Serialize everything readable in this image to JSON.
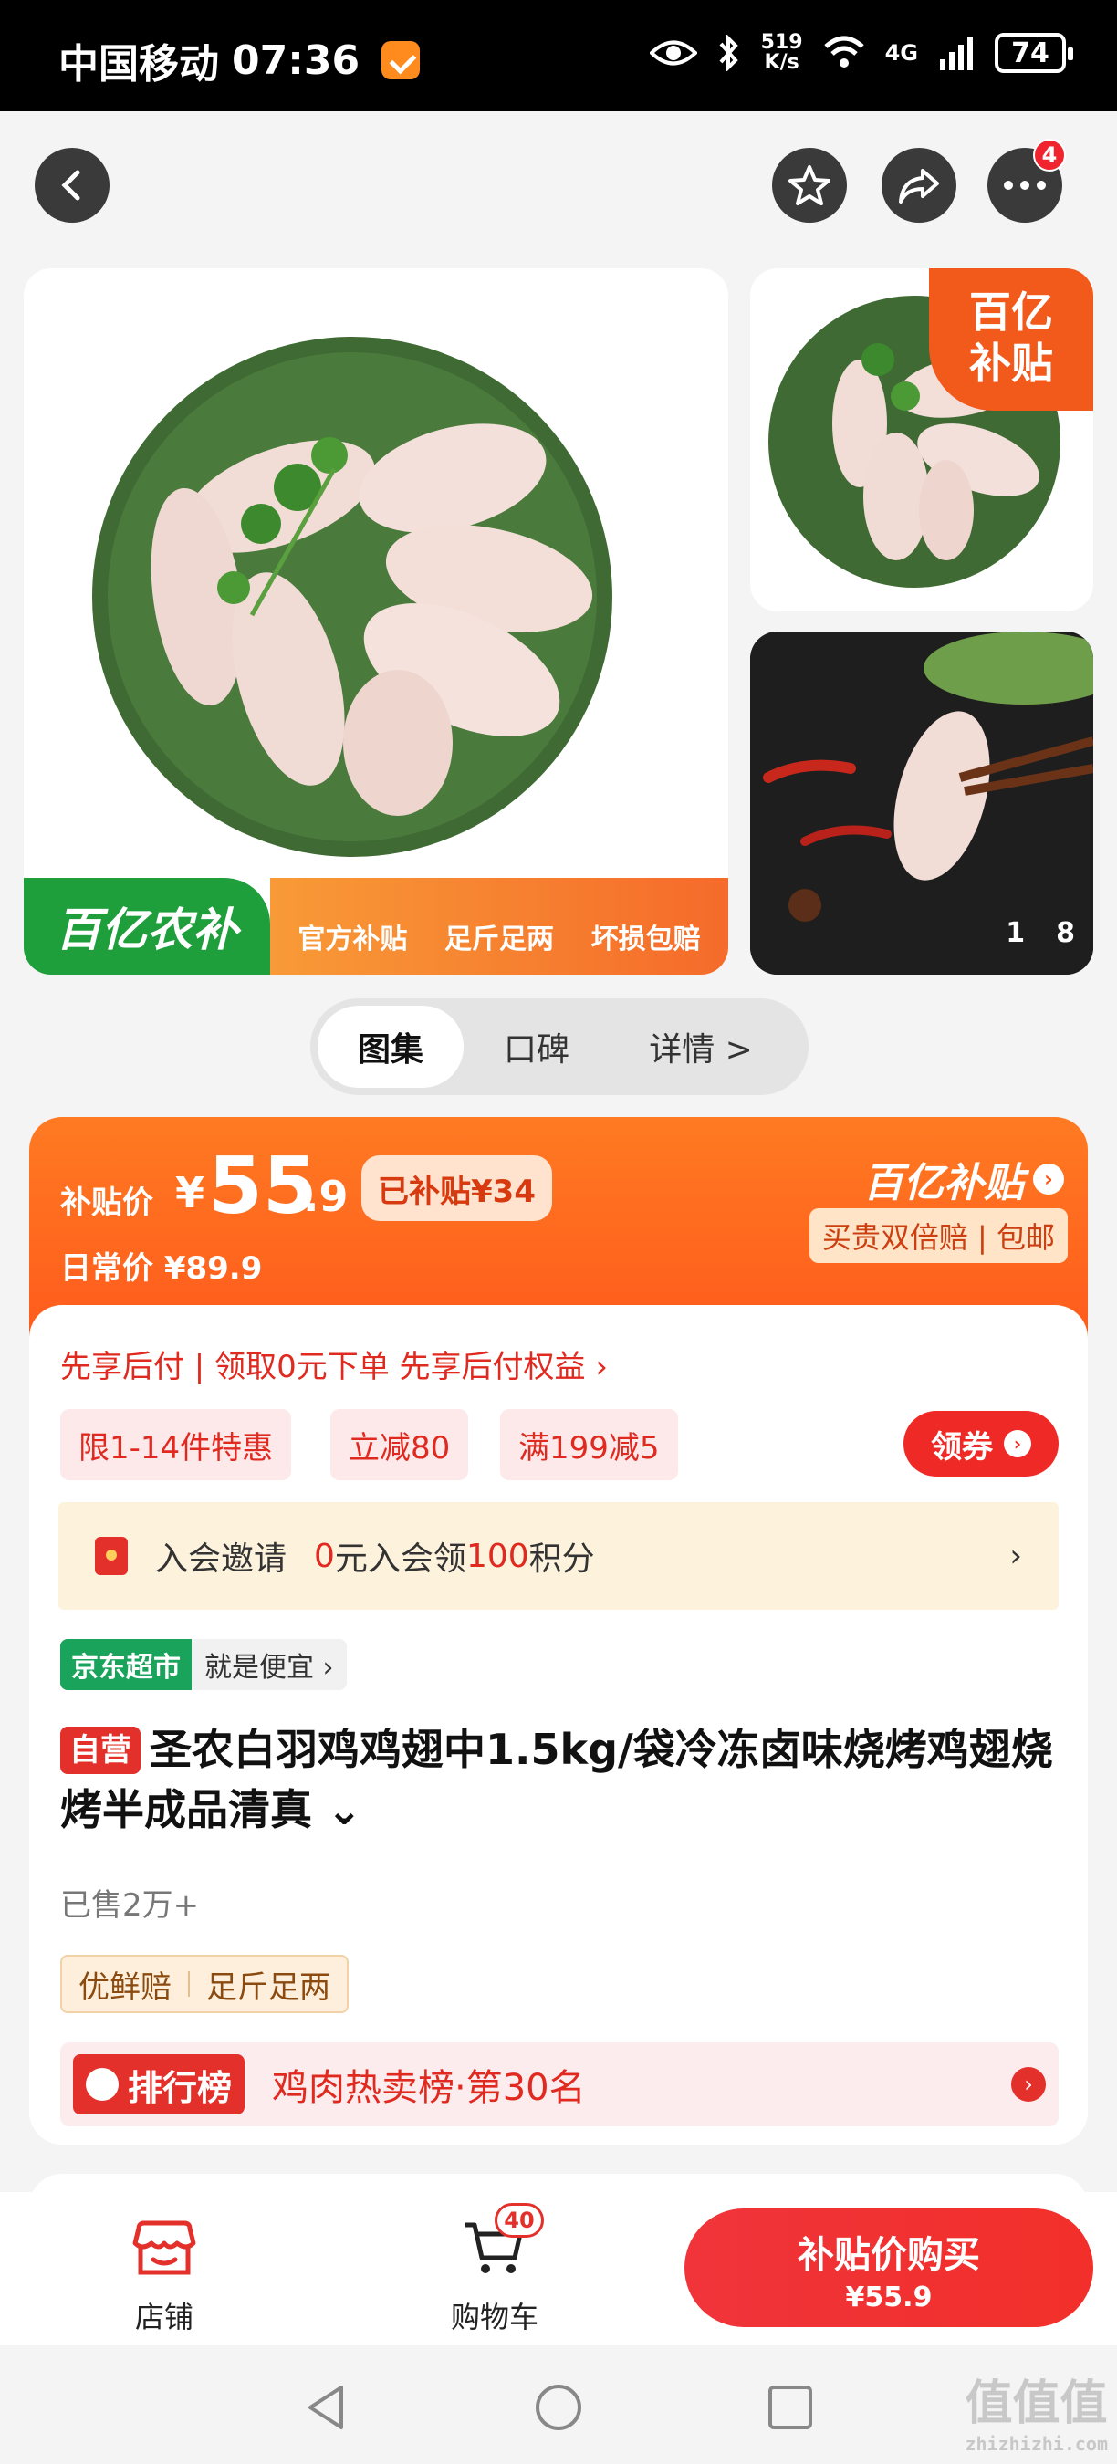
{
  "status_bar": {
    "carrier": "中国移动",
    "time": "07:36",
    "speed_value": "519",
    "speed_unit": "K/s",
    "network": "4G",
    "battery": "74"
  },
  "header": {
    "more_badge": "4"
  },
  "gallery": {
    "promo_brand": "百亿农补",
    "promo_items": [
      "官方补贴",
      "足斤足两",
      "坏损包赔"
    ],
    "subsidy_corner": [
      "百亿",
      "补贴"
    ],
    "counter_current": "1",
    "counter_total": "8"
  },
  "tabs": [
    "图集",
    "口碑",
    "详情 >"
  ],
  "price": {
    "label": "补贴价",
    "yen": "¥",
    "integer": "55",
    "decimal": ".9",
    "saved": "已补贴¥34",
    "daily": "日常价 ¥89.9",
    "brand": "百亿补贴",
    "guarantee": "买贵双倍赔 | 包邮"
  },
  "pay_later": "先享后付 | 领取0元下单 先享后付权益 ›",
  "coupons": [
    "限1-14件特惠",
    "立减80",
    "满199减5"
  ],
  "coupon_button": "领券",
  "member": {
    "lead": "入会邀请",
    "part1": "0",
    "part2": "元入会领",
    "part3": "100",
    "part4": "积分",
    "arrow": "›"
  },
  "jd": {
    "tag": "京东超市",
    "text": "就是便宜 ›"
  },
  "product": {
    "self_tag": "自营",
    "title": "圣农白羽鸡鸡翅中1.5kg/袋冷冻卤味烧烤鸡翅烧烤半成品清真 ⌄",
    "sold": "已售2万+",
    "tags": [
      "优鲜赔",
      "足斤足两"
    ]
  },
  "rank": {
    "tag": "排行榜",
    "text": "鸡肉热卖榜·第30名"
  },
  "bottom": {
    "store": "店铺",
    "cart": "购物车",
    "cart_count": "40",
    "buy_line1": "补贴价购买",
    "buy_line2": "¥55.9"
  },
  "watermark": {
    "main": "值值值",
    "sub": "zhizhizhi.com"
  }
}
